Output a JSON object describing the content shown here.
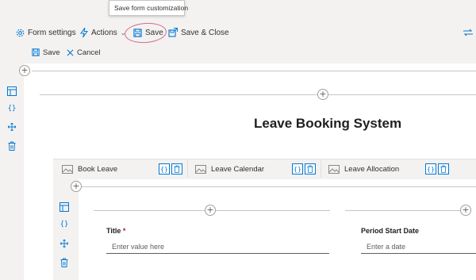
{
  "tooltip": {
    "text": "Save form customization"
  },
  "toolbar": {
    "form_settings": "Form settings",
    "actions": "Actions",
    "save": "Save",
    "save_close": "Save & Close"
  },
  "subtoolbar": {
    "save": "Save",
    "cancel": "Cancel"
  },
  "page": {
    "title": "Leave Booking System"
  },
  "tabs": [
    {
      "label": "Book Leave"
    },
    {
      "label": "Leave Calendar"
    },
    {
      "label": "Leave Allocation"
    }
  ],
  "fields": [
    {
      "label": "Title",
      "required_mark": "*",
      "placeholder": "Enter value here"
    },
    {
      "label": "Period Start Date",
      "placeholder": "Enter a date"
    }
  ],
  "icons": {
    "rail": [
      "section-settings-icon",
      "code-braces-icon",
      "move-icon",
      "trash-icon"
    ],
    "add": "add-plus-icon"
  },
  "colors": {
    "accent": "#0078d4",
    "annotation": "#d66b8a",
    "toolbar_bg": "#f3f2f1"
  }
}
